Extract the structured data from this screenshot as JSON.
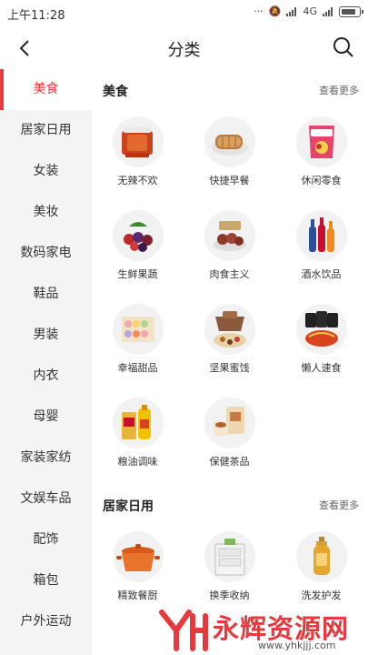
{
  "status_bar": {
    "time": "上午11:28",
    "network": "4G"
  },
  "nav": {
    "title": "分类"
  },
  "sidebar": {
    "items": [
      {
        "label": "美食",
        "active": true
      },
      {
        "label": "居家日用"
      },
      {
        "label": "女装"
      },
      {
        "label": "美妆"
      },
      {
        "label": "数码家电"
      },
      {
        "label": "鞋品"
      },
      {
        "label": "男装"
      },
      {
        "label": "内衣"
      },
      {
        "label": "母婴"
      },
      {
        "label": "家装家纺"
      },
      {
        "label": "文娱车品"
      },
      {
        "label": "配饰"
      },
      {
        "label": "箱包"
      },
      {
        "label": "户外运动"
      }
    ]
  },
  "sections": [
    {
      "title": "美食",
      "see_more": "查看更多",
      "items": [
        {
          "label": "无辣不欢",
          "icon": "meat-snack-icon"
        },
        {
          "label": "快捷早餐",
          "icon": "bread-icon"
        },
        {
          "label": "休闲零食",
          "icon": "chips-bag-icon"
        },
        {
          "label": "生鲜果蔬",
          "icon": "berries-icon"
        },
        {
          "label": "肉食主义",
          "icon": "braised-meat-icon"
        },
        {
          "label": "酒水饮品",
          "icon": "bottles-icon"
        },
        {
          "label": "幸福甜品",
          "icon": "macaron-box-icon"
        },
        {
          "label": "坚果蜜饯",
          "icon": "nut-box-icon"
        },
        {
          "label": "懒人速食",
          "icon": "instant-noodle-icon"
        },
        {
          "label": "粮油调味",
          "icon": "oil-rice-icon"
        },
        {
          "label": "保健茶品",
          "icon": "tea-box-icon"
        }
      ]
    },
    {
      "title": "居家日用",
      "see_more": "查看更多",
      "items": [
        {
          "label": "精致餐厨",
          "icon": "casserole-pot-icon"
        },
        {
          "label": "换季收纳",
          "icon": "storage-drawer-icon"
        },
        {
          "label": "洗发护发",
          "icon": "shampoo-bottle-icon"
        }
      ]
    }
  ],
  "watermark": {
    "text": "永辉资源网",
    "url": "www.yhkjjj.com"
  }
}
